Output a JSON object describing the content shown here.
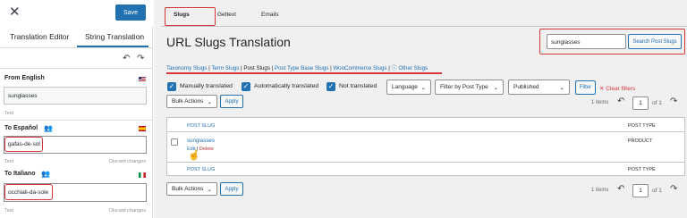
{
  "editor": {
    "close_icon": "close-icon",
    "save_label": "Save",
    "tabs": [
      {
        "label": "Translation Editor",
        "active": false
      },
      {
        "label": "String Translation",
        "active": true
      }
    ],
    "source": {
      "label": "From English",
      "value": "sunglasses",
      "hint": "Text"
    },
    "translations": [
      {
        "label": "To Español",
        "value": "gafas-de-sol",
        "hint": "Text",
        "discard_label": "Discard changes"
      },
      {
        "label": "To Italiano",
        "value": "occhiali-da-sole",
        "hint": "Text",
        "discard_label": "Discard changes"
      }
    ]
  },
  "main": {
    "tabs": [
      {
        "label": "Slugs",
        "active": true
      },
      {
        "label": "Gettext",
        "active": false
      },
      {
        "label": "Emails",
        "active": false
      }
    ],
    "title": "URL Slugs Translation",
    "search": {
      "value": "sunglasses",
      "button_label": "Search Post Slugs"
    },
    "sublinks": [
      {
        "label": "Taxonomy Slugs",
        "current": false
      },
      {
        "label": "Term Slugs",
        "current": false
      },
      {
        "label": "Post Slugs",
        "current": true
      },
      {
        "label": "Post Type Base Slugs",
        "current": false
      },
      {
        "label": "WooCommerce Slugs",
        "current": false
      },
      {
        "label": "Other Slugs",
        "current": false
      }
    ],
    "filters": {
      "checkboxes": [
        {
          "label": "Manually translated",
          "checked": true
        },
        {
          "label": "Automatically translated",
          "checked": true
        },
        {
          "label": "Not translated",
          "checked": true
        }
      ],
      "language": "Language",
      "post_type": "Filter by Post Type",
      "status": "Published",
      "filter_label": "Filter",
      "clear_label": "Clear filters"
    },
    "bulk": {
      "label": "Bulk Actions",
      "apply_label": "Apply"
    },
    "pagination": {
      "items_text": "1 items",
      "page": "1",
      "of_text": "of 1"
    },
    "table": {
      "headers": {
        "slug": "POST SLUG",
        "type": "POST TYPE"
      },
      "rows": [
        {
          "slug": "sunglasses",
          "type": "PRODUCT",
          "edit_label": "Edit",
          "delete_label": "Delete"
        }
      ]
    }
  },
  "colors": {
    "accent": "#2271b1",
    "highlight": "#d63638"
  }
}
